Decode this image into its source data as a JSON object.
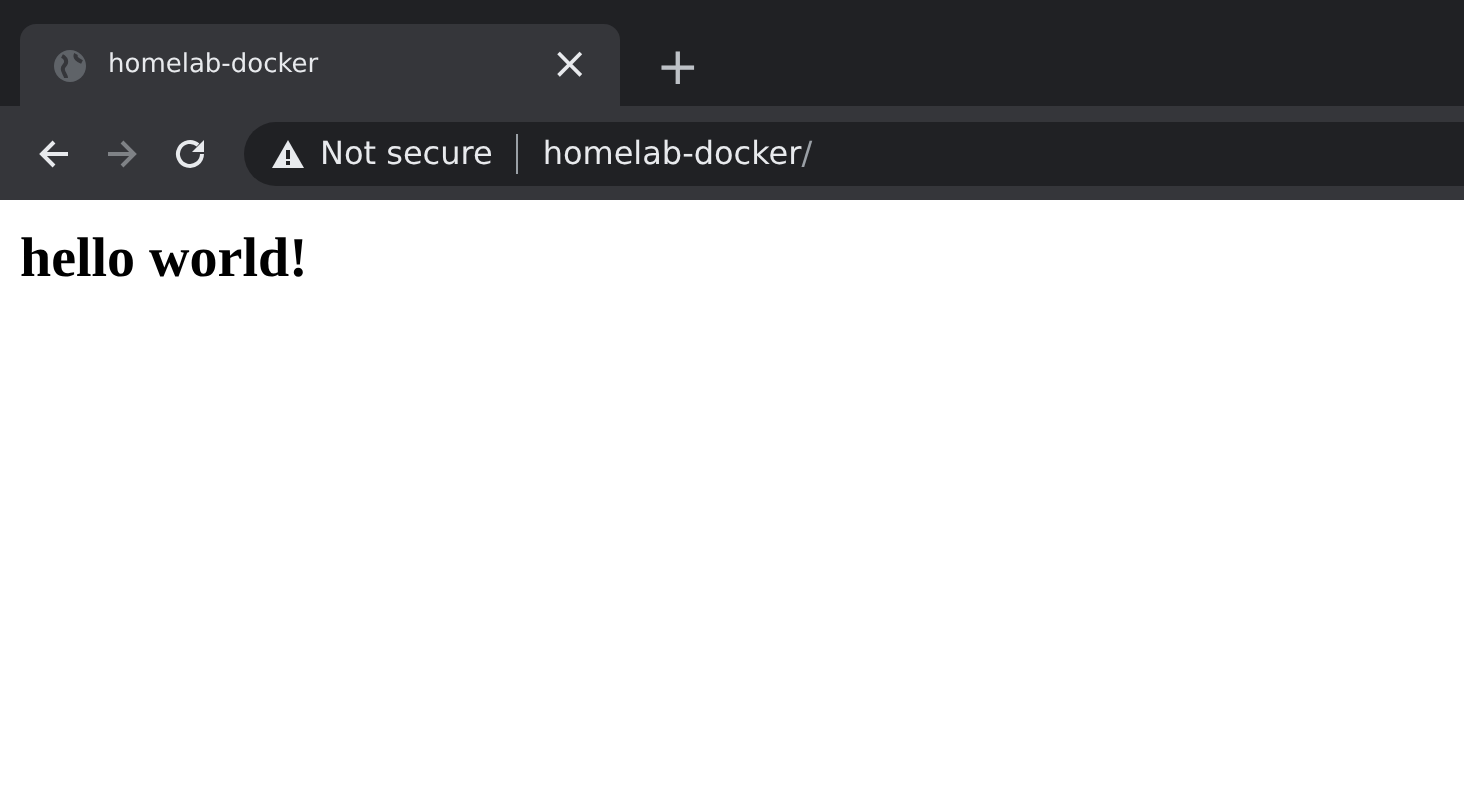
{
  "tabs": [
    {
      "title": "homelab-docker",
      "selected": true,
      "close": "×"
    }
  ],
  "new_tab": "+",
  "toolbar": {
    "back": {
      "disabled": false
    },
    "forward": {
      "disabled": true
    }
  },
  "address_bar": {
    "security": "Not secure",
    "host": "homelab-docker",
    "path": "/"
  },
  "page": {
    "heading": "hello world!"
  }
}
